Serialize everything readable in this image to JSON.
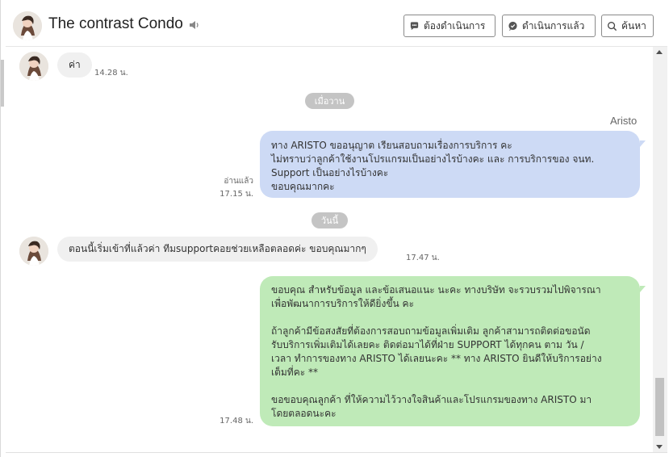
{
  "header": {
    "title": "The contrast Condo",
    "buttons": {
      "todo": "ต้องดำเนินการ",
      "done": "ดำเนินการแล้ว",
      "search": "ค้นหา"
    }
  },
  "messages": [
    {
      "side": "left",
      "text": "ค่า",
      "time": "14.28 น."
    },
    {
      "type": "separator",
      "text": "เมื่อวาน"
    },
    {
      "side": "right",
      "sender": "Aristo",
      "lines": [
        "ทาง ARISTO ขออนุญาต เรียนสอบถามเรื่องการบริการ คะ",
        "ไม่ทราบว่าลูกค้าใช้งานโปรแกรมเป็นอย่างไรบ้างคะ และ  การบริการของ จนท.",
        "Support เป็นอย่างไรบ้างคะ",
        "ขอบคุณมากคะ"
      ],
      "read": "อ่านแล้ว",
      "time": "17.15 น."
    },
    {
      "type": "separator",
      "text": "วันนี้"
    },
    {
      "side": "left",
      "text": "ตอนนี้เริ่มเข้าที่แล้วค่า ทีมsupportคอยช่วยเหลือตลอดค่ะ ขอบคุณมากๆ",
      "time": "17.47 น."
    },
    {
      "side": "right",
      "lines": [
        "ขอบคุณ สำหรับข้อมูล และข้อเสนอแนะ นะคะ ทางบริษัท จะรวบรวมไปพิจารณา",
        "เพื่อพัฒนาการบริการให้ดียิ่งขึ้น คะ",
        "",
        "ถ้าลูกค้ามีข้อสงสัยที่ต้องการสอบถามข้อมูลเพิ่มเติม ลูกค้าสามารถติดต่อขอนัด",
        "รับบริการเพิ่มเติมได้เลยคะ ติดต่อมาได้ที่ฝ่าย SUPPORT ได้ทุกคน ตาม วัน /",
        "เวลา ทำการของทาง ARISTO ได้เลยนะคะ ** ทาง ARISTO ยินดีให้บริการอย่าง",
        "เต็มที่คะ **",
        "",
        "ขอขอบคุณลูกค้า ที่ให้ความไว้วางใจสินค้าและโปรแกรมของทาง ARISTO มา",
        "โดยตลอดนะคะ"
      ],
      "time": "17.48 น."
    }
  ],
  "colors": {
    "bubble_blue": "#cddaf5",
    "bubble_green": "#bfeab8",
    "bubble_gray": "#f0f0f0",
    "separator": "#c4c4c4"
  },
  "icons": {
    "speaker": "speaker-icon",
    "todo": "chat-bubble-icon",
    "done": "chat-check-icon",
    "search": "search-icon"
  }
}
